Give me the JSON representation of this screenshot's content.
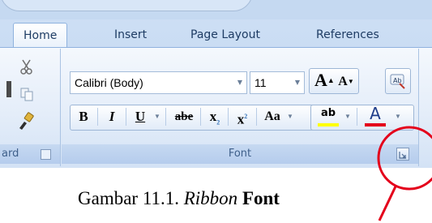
{
  "tabs": [
    {
      "label": "Home",
      "active": true
    },
    {
      "label": "Insert",
      "active": false
    },
    {
      "label": "Page Layout",
      "active": false
    },
    {
      "label": "References",
      "active": false
    }
  ],
  "left_group": {
    "label_fragment": "ard",
    "icons": [
      "scissors-icon",
      "copy-icon",
      "format-painter-icon"
    ]
  },
  "font_group": {
    "font_name": "Calibri (Body)",
    "font_size": "11",
    "label": "Font",
    "buttons": {
      "grow_font": "A",
      "shrink_font": "A",
      "bold": "B",
      "italic": "I",
      "underline": "U",
      "strikethrough": "abe",
      "subscript": "x",
      "subscript_mark": "2",
      "superscript": "x",
      "superscript_mark": "2",
      "change_case": "Aa",
      "highlight": "ab",
      "font_color": "A"
    }
  },
  "caption": {
    "prefix": "Gambar 11.1.",
    "italic": "Ribbon",
    "bold": "Font"
  },
  "colors": {
    "highlight_marker": "#e81b1b",
    "font_color_bar": "#e4001b",
    "highlight_bar": "#ffff00",
    "annotation": "#e4001b"
  }
}
